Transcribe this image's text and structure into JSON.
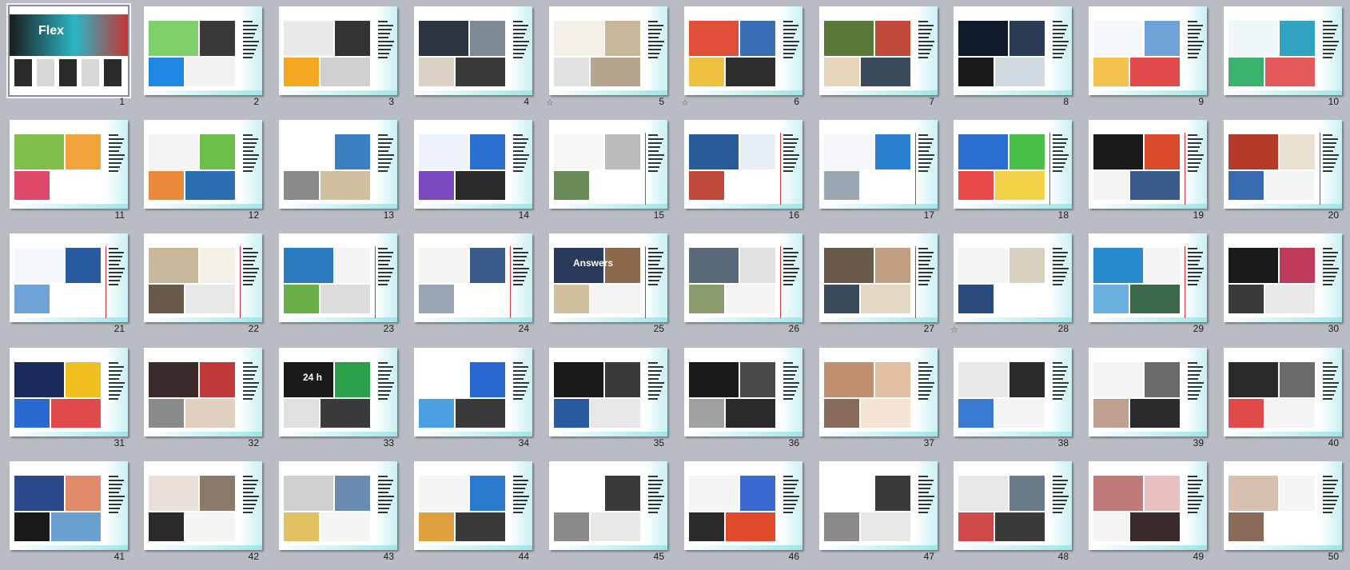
{
  "slides": [
    {
      "n": "1",
      "tag": "",
      "title": "",
      "style": "cover",
      "colors": [
        "#1c1c1c",
        "#2ab6c4",
        "#e8e8e8",
        "#c83434"
      ],
      "cover_word": "Flex"
    },
    {
      "n": "2",
      "tag": "",
      "title": "",
      "style": "red",
      "colors": [
        "#7fd06b",
        "#3a3a3a",
        "#1e88e5",
        "#f2f2f2"
      ]
    },
    {
      "n": "3",
      "tag": "",
      "title": "",
      "style": "red",
      "colors": [
        "#e9e9e9",
        "#333333",
        "#f5a623",
        "#d0d0d0"
      ]
    },
    {
      "n": "4",
      "tag": "",
      "title": "",
      "style": "red",
      "colors": [
        "#2c3440",
        "#7d8a96",
        "#d9d2c5",
        "#3a3a3a"
      ]
    },
    {
      "n": "5",
      "tag": "",
      "title": "",
      "style": "red",
      "colors": [
        "#f3efe6",
        "#c7b89a",
        "#e0e0e0",
        "#b5a58f"
      ],
      "star": true
    },
    {
      "n": "6",
      "tag": "",
      "title": "",
      "style": "red",
      "colors": [
        "#e04f3a",
        "#3a6fb5",
        "#f0c040",
        "#2d2d2d"
      ],
      "star": true
    },
    {
      "n": "7",
      "tag": "",
      "title": "",
      "style": "red",
      "colors": [
        "#5a7a3a",
        "#c04a3a",
        "#e6d5b8",
        "#3a4a5a"
      ]
    },
    {
      "n": "8",
      "tag": "",
      "title": "",
      "style": "red",
      "colors": [
        "#0f1a2a",
        "#2b3d55",
        "#1a1a1a",
        "#d0d8e0"
      ]
    },
    {
      "n": "9",
      "tag": "",
      "title": "",
      "style": "red",
      "colors": [
        "#f5f8fb",
        "#6fa3d8",
        "#f3c24a",
        "#e04a4a"
      ]
    },
    {
      "n": "10",
      "tag": "",
      "title": "",
      "style": "red",
      "colors": [
        "#eef6f8",
        "#2fa3c0",
        "#3bb26e",
        "#e45a5a"
      ]
    },
    {
      "n": "11",
      "tag": "",
      "title": "",
      "style": "blue",
      "colors": [
        "#7fbf4a",
        "#f2a33a",
        "#e04a6a",
        "#ffffff"
      ]
    },
    {
      "n": "12",
      "tag": "",
      "title": "",
      "style": "red",
      "colors": [
        "#f4f4f4",
        "#6cc04a",
        "#e88a3a",
        "#2a6fb0"
      ]
    },
    {
      "n": "13",
      "tag": "",
      "title": "",
      "style": "blue",
      "colors": [
        "#ffffff",
        "#3a7fc0",
        "#8a8a8a",
        "#d0c0a0"
      ]
    },
    {
      "n": "14",
      "tag": "",
      "title": "",
      "style": "blue",
      "colors": [
        "#eef2fb",
        "#2a6fd0",
        "#7a4ac0",
        "#2a2a2a"
      ]
    },
    {
      "n": "15",
      "tag": "",
      "title": "",
      "style": "blue",
      "colors": [
        "#f7f7f7",
        "#bcbcbc",
        "#6a8a5a",
        "#ffffff"
      ]
    },
    {
      "n": "16",
      "tag": "",
      "title": "",
      "style": "blue",
      "colors": [
        "#2a5a9a",
        "#e8eef6",
        "#c04a3a",
        "#ffffff"
      ]
    },
    {
      "n": "17",
      "tag": "",
      "title": "",
      "style": "blue",
      "colors": [
        "#f5f7fa",
        "#2a7fd0",
        "#9aa6b4",
        "#ffffff"
      ]
    },
    {
      "n": "18",
      "tag": "",
      "title": "",
      "style": "blue",
      "colors": [
        "#2a6fd0",
        "#4ac04a",
        "#e84a4a",
        "#f3d24a"
      ]
    },
    {
      "n": "19",
      "tag": "",
      "title": "",
      "style": "blue",
      "colors": [
        "#1a1a1a",
        "#d84a2a",
        "#f4f4f4",
        "#3a5a8a"
      ]
    },
    {
      "n": "20",
      "tag": "",
      "title": "",
      "style": "blue",
      "colors": [
        "#b43a2a",
        "#e8e0d0",
        "#3a6ab0",
        "#f4f4f4"
      ]
    },
    {
      "n": "21",
      "tag": "",
      "title": "",
      "style": "blue",
      "colors": [
        "#f4f7fb",
        "#2a5aa0",
        "#6fa3d8",
        "#ffffff"
      ]
    },
    {
      "n": "22",
      "tag": "",
      "title": "",
      "style": "blue",
      "colors": [
        "#c9b89a",
        "#f4f0e6",
        "#6a5a4a",
        "#e8e8e8"
      ]
    },
    {
      "n": "23",
      "tag": "",
      "title": "",
      "style": "blue",
      "colors": [
        "#2a7ac0",
        "#f4f4f4",
        "#6ab04a",
        "#dcdcdc"
      ]
    },
    {
      "n": "24",
      "tag": "",
      "title": "",
      "style": "blue",
      "colors": [
        "#f4f4f4",
        "#3a5a8a",
        "#9aa6b4",
        "#ffffff"
      ]
    },
    {
      "n": "25",
      "tag": "",
      "title": "",
      "style": "blue",
      "colors": [
        "#2a3a5a",
        "#8a6a4a",
        "#d0c0a0",
        "#f4f4f4"
      ],
      "overlay_word": "Answers"
    },
    {
      "n": "26",
      "tag": "",
      "title": "",
      "style": "blue",
      "colors": [
        "#5a6a7a",
        "#e0e0e0",
        "#8a9a6a",
        "#f4f4f4"
      ]
    },
    {
      "n": "27",
      "tag": "",
      "title": "",
      "style": "blue",
      "colors": [
        "#6a5a4a",
        "#c0a080",
        "#3a4a5a",
        "#e4d8c4"
      ]
    },
    {
      "n": "28",
      "tag": "",
      "title": "",
      "style": "plain",
      "colors": [
        "#f4f4f4",
        "#d8d0c0",
        "#2a4a7a",
        "#ffffff"
      ],
      "star": true
    },
    {
      "n": "29",
      "tag": "",
      "title": "",
      "style": "blue",
      "colors": [
        "#2a8ad0",
        "#f4f4f4",
        "#6ab0e0",
        "#3a6a4a"
      ]
    },
    {
      "n": "30",
      "tag": "",
      "title": "",
      "style": "green",
      "colors": [
        "#1a1a1a",
        "#c03a5a",
        "#3a3a3a",
        "#e8e8e8"
      ]
    },
    {
      "n": "31",
      "tag": "",
      "title": "",
      "style": "blue",
      "colors": [
        "#1a2a5a",
        "#f0c020",
        "#2a6ad0",
        "#e04a4a"
      ]
    },
    {
      "n": "32",
      "tag": "",
      "title": "",
      "style": "green",
      "colors": [
        "#3a2a2a",
        "#c03a3a",
        "#8a8a8a",
        "#e0d0c0"
      ]
    },
    {
      "n": "33",
      "tag": "",
      "title": "",
      "style": "blue",
      "colors": [
        "#1a1a1a",
        "#2aa04a",
        "#e0e0e0",
        "#3a3a3a"
      ],
      "overlay_word": "24 h"
    },
    {
      "n": "34",
      "tag": "",
      "title": "",
      "style": "plain",
      "colors": [
        "#ffffff",
        "#2a6ad0",
        "#4aa0e0",
        "#3a3a3a"
      ]
    },
    {
      "n": "35",
      "tag": "",
      "title": "",
      "style": "green",
      "colors": [
        "#1a1a1a",
        "#3a3a3a",
        "#2a5aa0",
        "#e8e8e8"
      ]
    },
    {
      "n": "36",
      "tag": "",
      "title": "",
      "style": "green",
      "colors": [
        "#1a1a1a",
        "#4a4a4a",
        "#a0a0a0",
        "#2a2a2a"
      ]
    },
    {
      "n": "37",
      "tag": "",
      "title": "",
      "style": "green",
      "colors": [
        "#c09070",
        "#e0c0a0",
        "#8a6a5a",
        "#f4e4d4"
      ]
    },
    {
      "n": "38",
      "tag": "",
      "title": "",
      "style": "green",
      "colors": [
        "#e8e8e8",
        "#2a2a2a",
        "#3a7ad0",
        "#f4f4f4"
      ]
    },
    {
      "n": "39",
      "tag": "",
      "title": "",
      "style": "green",
      "colors": [
        "#f4f4f4",
        "#6a6a6a",
        "#c0a090",
        "#2a2a2a"
      ]
    },
    {
      "n": "40",
      "tag": "",
      "title": "",
      "style": "green",
      "colors": [
        "#2a2a2a",
        "#6a6a6a",
        "#e04a4a",
        "#f4f4f4"
      ]
    },
    {
      "n": "41",
      "tag": "",
      "title": "",
      "style": "blue",
      "colors": [
        "#2a4a8a",
        "#e08a6a",
        "#1a1a1a",
        "#6aa0d0"
      ]
    },
    {
      "n": "42",
      "tag": "",
      "title": "",
      "style": "blue",
      "colors": [
        "#e8e0d8",
        "#8a7a6a",
        "#2a2a2a",
        "#f4f4f4"
      ]
    },
    {
      "n": "43",
      "tag": "",
      "title": "",
      "style": "blue",
      "colors": [
        "#d0d0d0",
        "#6a8ab0",
        "#e0c060",
        "#f4f4f4"
      ]
    },
    {
      "n": "44",
      "tag": "",
      "title": "",
      "style": "orange",
      "colors": [
        "#f4f4f4",
        "#2a7ad0",
        "#e0a040",
        "#3a3a3a"
      ]
    },
    {
      "n": "45",
      "tag": "",
      "title": "",
      "style": "orange",
      "colors": [
        "#ffffff",
        "#3a3a3a",
        "#8a8a8a",
        "#e8e8e8"
      ]
    },
    {
      "n": "46",
      "tag": "",
      "title": "",
      "style": "orange",
      "colors": [
        "#f4f4f4",
        "#3a6ad0",
        "#2a2a2a",
        "#e04a2a"
      ]
    },
    {
      "n": "47",
      "tag": "",
      "title": "",
      "style": "orange",
      "colors": [
        "#ffffff",
        "#3a3a3a",
        "#8a8a8a",
        "#e8e8e8"
      ]
    },
    {
      "n": "48",
      "tag": "",
      "title": "",
      "style": "plain",
      "colors": [
        "#e8e8e8",
        "#6a7a8a",
        "#d04a4a",
        "#3a3a3a"
      ]
    },
    {
      "n": "49",
      "tag": "",
      "title": "",
      "style": "blue",
      "colors": [
        "#c07a7a",
        "#e8c0c0",
        "#f4f4f4",
        "#3a2a2a"
      ]
    },
    {
      "n": "50",
      "tag": "",
      "title": "",
      "style": "blue",
      "colors": [
        "#d8c0b0",
        "#f4f4f4",
        "#8a6a5a",
        "#ffffff"
      ]
    }
  ]
}
